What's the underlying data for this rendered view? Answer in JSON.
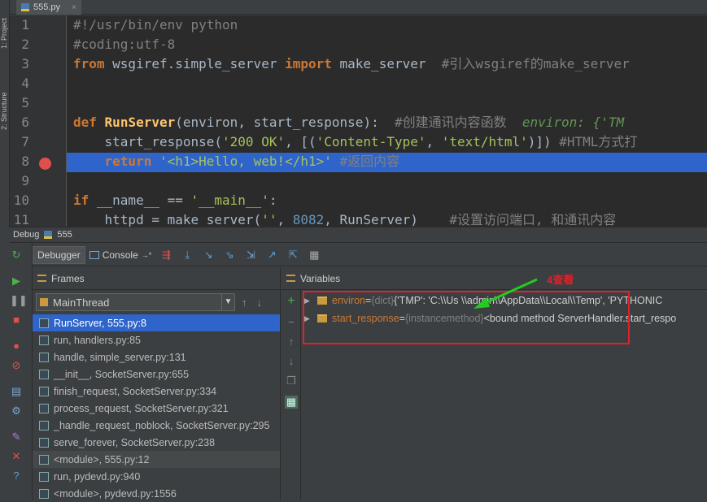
{
  "editor_tab": {
    "filename": "555.py",
    "close": "×"
  },
  "left_tool_tabs": [
    "1: Project",
    "2: Structure"
  ],
  "code": {
    "line_numbers": [
      "1",
      "2",
      "3",
      "4",
      "5",
      "6",
      "7",
      "8",
      "9",
      "10",
      "11"
    ],
    "line1": "#!/usr/bin/env python",
    "line2": "#coding:utf-8",
    "line3_kw_from": "from",
    "line3_mod": " wsgiref.simple_server ",
    "line3_kw_import": "import",
    "line3_name": " make_server  ",
    "line3_comment": "#引入wsgiref的make_server",
    "line6_kw": "def",
    "line6_fn": "RunServer",
    "line6_params": "(environ, start_response):  ",
    "line6_comment": "#创建通讯内容函数  ",
    "line6_hint": "environ: {'TM",
    "line7_call": "    start_response(",
    "line7_s1": "'200 OK'",
    "line7_mid": ", [(",
    "line7_s2": "'Content-Type'",
    "line7_comma": ", ",
    "line7_s3": "'text/html'",
    "line7_end": ")]) ",
    "line7_comment": "#HTML方式打",
    "line8_kw": "    return ",
    "line8_str": "'<h1>Hello, web!</h1>'",
    "line8_comment": " #返回内容",
    "line10_kw": "if",
    "line10_name": " __name__ == ",
    "line10_str": "'__main__'",
    "line10_end": ":",
    "line11_a": "    httpd = make_server(",
    "line11_str": "''",
    "line11_comma": ", ",
    "line11_num": "8082",
    "line11_b": ", RunServer)    ",
    "line11_comment": "#设置访问端口, 和通讯内容"
  },
  "debug_header": {
    "label": "Debug",
    "config": "555"
  },
  "toolbar": {
    "debugger_tab": "Debugger",
    "console_tab": "Console"
  },
  "frames_panel": {
    "title": "Frames",
    "thread": "MainThread",
    "frames": [
      "RunServer, 555.py:8",
      "run, handlers.py:85",
      "handle, simple_server.py:131",
      "__init__, SocketServer.py:655",
      "finish_request, SocketServer.py:334",
      "process_request, SocketServer.py:321",
      "_handle_request_noblock, SocketServer.py:295",
      "serve_forever, SocketServer.py:238",
      "<module>, 555.py:12",
      "run, pydevd.py:940",
      "<module>, pydevd.py:1556"
    ]
  },
  "variables_panel": {
    "title": "Variables",
    "rows": [
      {
        "name": "environ",
        "eq": " = ",
        "type": "{dict}",
        "value": " {'TMP': 'C:\\\\Us    \\\\admin\\\\AppData\\\\Local\\\\Temp', 'PYTHONIC"
      },
      {
        "name": "start_response",
        "eq": " = ",
        "type": "{instancemethod}",
        "value": " <bound method ServerHandler.start_respo"
      }
    ]
  },
  "annotation": {
    "text": "4查看",
    "color": "#e0202a",
    "arrow_color": "#22cc22"
  }
}
